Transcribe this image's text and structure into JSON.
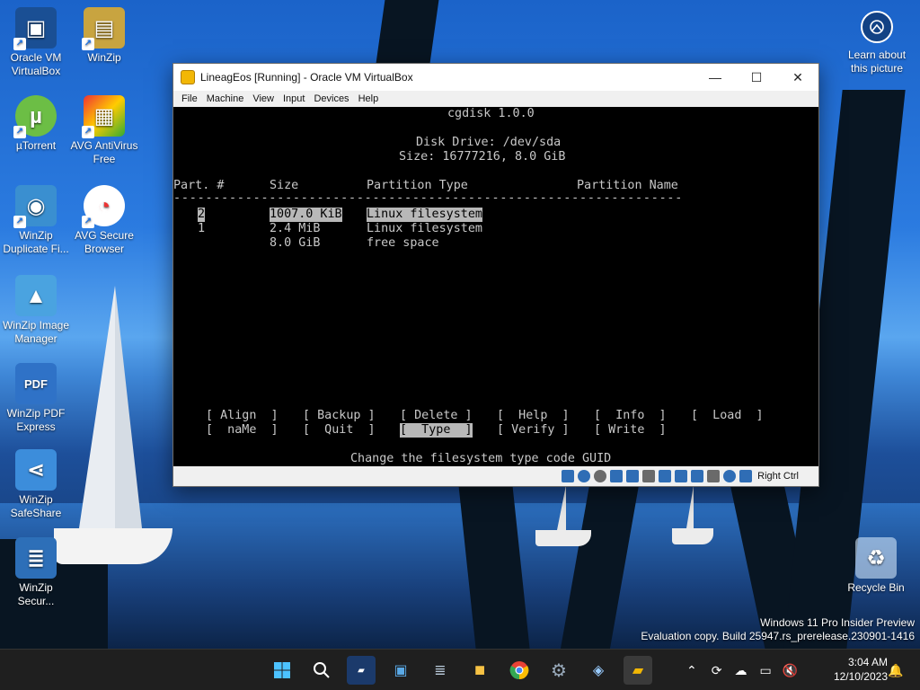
{
  "desktop": {
    "icons": [
      {
        "label": "Oracle VM\nVirtualBox",
        "icon": "virtualbox-icon"
      },
      {
        "label": "WinZip",
        "icon": "winzip-icon"
      },
      {
        "label": "µTorrent",
        "icon": "utorrent-icon"
      },
      {
        "label": "AVG AntiVirus\nFree",
        "icon": "avg-antivirus-icon"
      },
      {
        "label": "WinZip\nDuplicate Fi...",
        "icon": "winzip-duplicate-icon"
      },
      {
        "label": "AVG Secure\nBrowser",
        "icon": "avg-browser-icon"
      },
      {
        "label": "WinZip Image\nManager",
        "icon": "winzip-image-icon"
      },
      {
        "label": "WinZip PDF\nExpress",
        "icon": "winzip-pdf-icon"
      },
      {
        "label": "WinZip\nSafeShare",
        "icon": "winzip-safeshare-icon"
      },
      {
        "label": "WinZip\nSecur...",
        "icon": "winzip-secure-icon"
      },
      {
        "label": "Recycle Bin",
        "icon": "recycle-bin-icon"
      }
    ],
    "learn_about": "Learn about\nthis picture",
    "watermark_line1": "Windows 11 Pro Insider Preview",
    "watermark_line2": "Evaluation copy. Build 25947.rs_prerelease.230901-1416"
  },
  "window": {
    "title": "LineagEos [Running] - Oracle VM VirtualBox",
    "menu": [
      "File",
      "Machine",
      "View",
      "Input",
      "Devices",
      "Help"
    ],
    "status_hostkey": "Right Ctrl"
  },
  "cgdisk": {
    "header": "cgdisk 1.0.0",
    "drive": "Disk Drive: /dev/sda",
    "size": "Size: 16777216, 8.0 GiB",
    "columns": {
      "part": "Part. #",
      "size": "Size",
      "type": "Partition Type",
      "name": "Partition Name"
    },
    "dashes": "----------------------------------------------------------------",
    "rows": [
      {
        "part": "2",
        "size": "1007.0 KiB",
        "type": "Linux filesystem",
        "selected": true
      },
      {
        "part": "1",
        "size": "2.4 MiB",
        "type": "Linux filesystem",
        "selected": false
      },
      {
        "part": "",
        "size": "8.0 GiB",
        "type": "free space",
        "selected": false
      }
    ],
    "menu_row1": [
      "[ Align  ]",
      "[ Backup ]",
      "[ Delete ]",
      "[  Help  ]",
      "[  Info  ]",
      "[  Load  ]"
    ],
    "menu_row2": [
      "[  naMe  ]",
      "[  Quit  ]",
      "[  Type  ]",
      "[ Verify ]",
      "[ Write  ]"
    ],
    "selected_action": "[  Type  ]",
    "hint": "Change the filesystem type code GUID"
  },
  "taskbar": {
    "time": "3:04 AM",
    "date": "12/10/2023"
  },
  "colors": {
    "console_bg": "#000000",
    "console_fg": "#c8c8c8",
    "highlight_bg": "#b8b8b8",
    "taskbar_bg": "#1f1f1f"
  }
}
